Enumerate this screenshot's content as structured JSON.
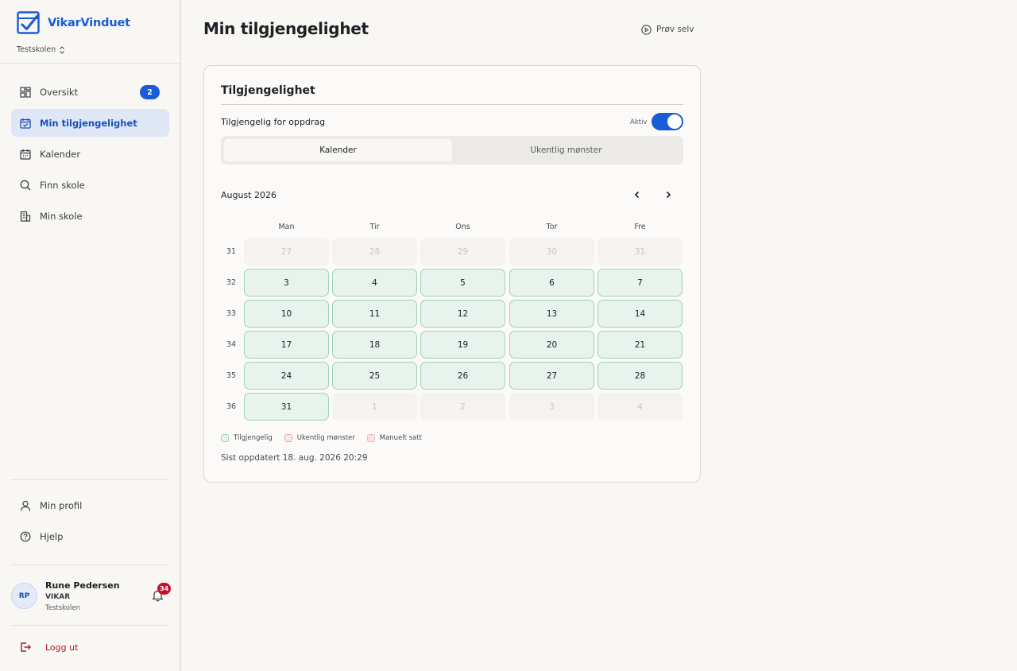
{
  "brand": {
    "name": "VikarVinduet",
    "accent": "#1a5bd6"
  },
  "school_selector": {
    "value": "Testskolen"
  },
  "nav": {
    "items": [
      {
        "label": "Oversikt",
        "icon": "grid-icon",
        "badge": "2"
      },
      {
        "label": "Min tilgjengelighet",
        "icon": "calendar-check-icon",
        "active": true
      },
      {
        "label": "Kalender",
        "icon": "calendar-icon"
      },
      {
        "label": "Finn skole",
        "icon": "search-icon"
      },
      {
        "label": "Min skole",
        "icon": "building-icon"
      }
    ],
    "bottom": [
      {
        "label": "Min profil",
        "icon": "user-icon"
      },
      {
        "label": "Hjelp",
        "icon": "help-icon"
      }
    ]
  },
  "user": {
    "initials": "RP",
    "name": "Rune Pedersen",
    "role": "VIKAR",
    "school": "Testskolen",
    "notifications": "34"
  },
  "logout": {
    "label": "Logg ut",
    "color": "#b0142a"
  },
  "page": {
    "title": "Min tilgjengelighet",
    "try_label": "Prøv selv"
  },
  "card": {
    "title": "Tilgjengelighet",
    "available_label": "Tilgjengelig for oppdrag",
    "toggle_status": "Aktiv",
    "toggle_on": true,
    "tabs": [
      "Kalender",
      "Ukentlig mønster"
    ],
    "active_tab": 0,
    "month": "August 2026",
    "weekdays": [
      "Man",
      "Tir",
      "Ons",
      "Tor",
      "Fre"
    ],
    "weeks": [
      {
        "week": "31",
        "days": [
          {
            "d": "27",
            "s": "muted"
          },
          {
            "d": "28",
            "s": "muted"
          },
          {
            "d": "29",
            "s": "muted"
          },
          {
            "d": "30",
            "s": "muted"
          },
          {
            "d": "31",
            "s": "muted"
          }
        ]
      },
      {
        "week": "32",
        "days": [
          {
            "d": "3",
            "s": "avail"
          },
          {
            "d": "4",
            "s": "avail"
          },
          {
            "d": "5",
            "s": "avail"
          },
          {
            "d": "6",
            "s": "avail"
          },
          {
            "d": "7",
            "s": "avail"
          }
        ]
      },
      {
        "week": "33",
        "days": [
          {
            "d": "10",
            "s": "avail"
          },
          {
            "d": "11",
            "s": "avail"
          },
          {
            "d": "12",
            "s": "avail"
          },
          {
            "d": "13",
            "s": "avail"
          },
          {
            "d": "14",
            "s": "avail"
          }
        ]
      },
      {
        "week": "34",
        "days": [
          {
            "d": "17",
            "s": "avail"
          },
          {
            "d": "18",
            "s": "avail"
          },
          {
            "d": "19",
            "s": "avail"
          },
          {
            "d": "20",
            "s": "avail"
          },
          {
            "d": "21",
            "s": "avail"
          }
        ]
      },
      {
        "week": "35",
        "days": [
          {
            "d": "24",
            "s": "avail"
          },
          {
            "d": "25",
            "s": "avail"
          },
          {
            "d": "26",
            "s": "avail"
          },
          {
            "d": "27",
            "s": "avail"
          },
          {
            "d": "28",
            "s": "avail"
          }
        ]
      },
      {
        "week": "36",
        "days": [
          {
            "d": "31",
            "s": "avail"
          },
          {
            "d": "1",
            "s": "muted"
          },
          {
            "d": "2",
            "s": "muted"
          },
          {
            "d": "3",
            "s": "muted"
          },
          {
            "d": "4",
            "s": "muted"
          }
        ]
      }
    ],
    "legend": [
      {
        "label": "Tilgjengelig",
        "color": "#e7f3ec",
        "border": "#9fd3b5"
      },
      {
        "label": "Ukentlig mønster",
        "color": "#fbe9ea",
        "border": "#e8a9ae"
      },
      {
        "label": "Manuelt satt",
        "color": "#fbe4e4",
        "border": "#f0b8b8"
      }
    ],
    "updated": "Sist oppdatert 18. aug. 2026 20:29"
  }
}
